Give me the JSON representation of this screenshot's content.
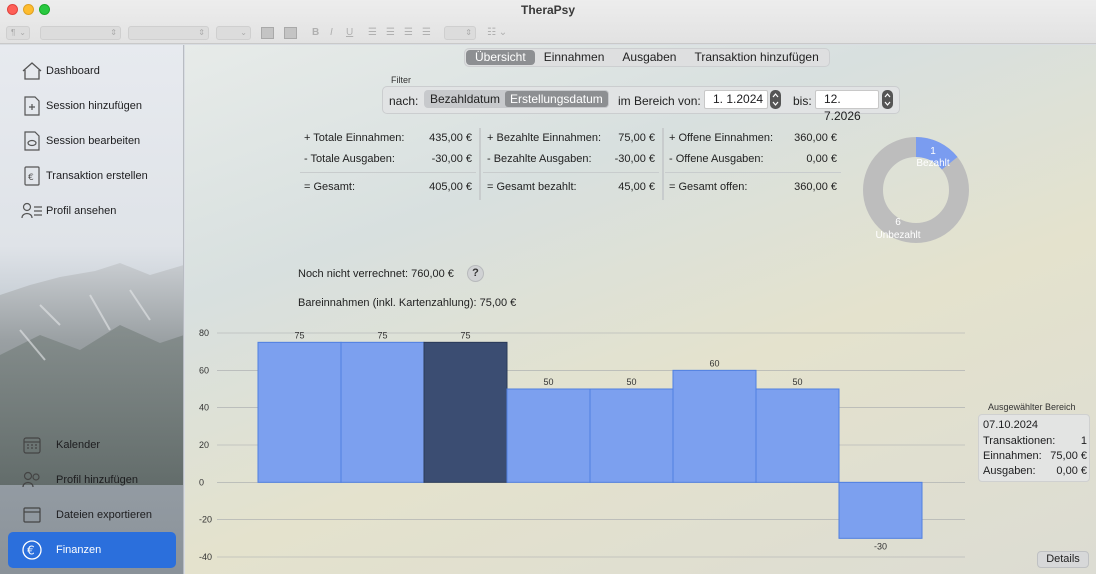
{
  "window": {
    "title": "TheraPsy"
  },
  "toolbar": {
    "paragraph_style": "¶",
    "bold": "B",
    "italic": "I",
    "underline": "U"
  },
  "sidebar": {
    "items": [
      {
        "label": "Dashboard",
        "icon": "house-icon"
      },
      {
        "label": "Session hinzufügen",
        "icon": "doc-plus-icon"
      },
      {
        "label": "Session bearbeiten",
        "icon": "doc-edit-icon"
      },
      {
        "label": "Transaktion erstellen",
        "icon": "euro-doc-icon"
      },
      {
        "label": "Profil ansehen",
        "icon": "person-list-icon"
      }
    ],
    "lower_items": [
      {
        "label": "Kalender",
        "icon": "calendar-icon"
      },
      {
        "label": "Profil hinzufügen",
        "icon": "person-plus-icon"
      },
      {
        "label": "Dateien exportieren",
        "icon": "archive-icon"
      },
      {
        "label": "Finanzen",
        "icon": "euro-circle-icon",
        "active": true
      }
    ]
  },
  "tabs": [
    "Übersicht",
    "Einnahmen",
    "Ausgaben",
    "Transaktion hinzufügen"
  ],
  "filter": {
    "title": "Filter",
    "by_label": "nach:",
    "options": [
      "Bezahldatum",
      "Erstellungsdatum"
    ],
    "selected": "Erstellungsdatum",
    "range_label": "im Bereich von:",
    "from": "1.  1.2024",
    "to_label": "bis:",
    "to": "12.  7.2026"
  },
  "stats": {
    "col1": [
      {
        "label": "+ Totale Einnahmen:",
        "value": "435,00 €"
      },
      {
        "label": "- Totale Ausgaben:",
        "value": "-30,00 €"
      },
      {
        "label": "= Gesamt:",
        "value": "405,00 €"
      }
    ],
    "col2": [
      {
        "label": "+ Bezahlte Einnahmen:",
        "value": "75,00 €"
      },
      {
        "label": "- Bezahlte Ausgaben:",
        "value": "-30,00 €"
      },
      {
        "label": "= Gesamt bezahlt:",
        "value": "45,00 €"
      }
    ],
    "col3": [
      {
        "label": "+ Offene Einnahmen:",
        "value": "360,00 €"
      },
      {
        "label": "- Offene Ausgaben:",
        "value": "0,00 €"
      },
      {
        "label": "= Gesamt offen:",
        "value": "360,00 €"
      }
    ]
  },
  "donut": {
    "paid": {
      "count": "1",
      "label": "Bezahlt",
      "value": 1,
      "color": "#7a9cf0"
    },
    "unpaid": {
      "count": "6",
      "label": "Unbezahlt",
      "value": 6,
      "color": "#bdbdbd"
    }
  },
  "not_billed": "Noch nicht verrechnet: 760,00 €",
  "help": "?",
  "cash_income": "Bareinnahmen (inkl. Kartenzahlung): 75,00 €",
  "chart_data": {
    "type": "bar",
    "categories": [
      "",
      "",
      "",
      "",
      "",
      "",
      "",
      ""
    ],
    "values": [
      75,
      75,
      75,
      50,
      50,
      60,
      50,
      -30
    ],
    "selected_index": 2,
    "ylim": [
      -40,
      80
    ],
    "yticks": [
      80,
      60,
      40,
      20,
      0,
      -20,
      -40
    ],
    "grid": true,
    "bar_color": "#7ca0ef",
    "selected_color": "#3b4d72",
    "title": "",
    "xlabel": "",
    "ylabel": ""
  },
  "selected_range": {
    "title": "Ausgewählter Bereich",
    "date": "07.10.2024",
    "transactions_label": "Transaktionen:",
    "transactions": "1",
    "income_label": "Einnahmen:",
    "income": "75,00 €",
    "expenses_label": "Ausgaben:",
    "expenses": "0,00 €"
  },
  "details_button": "Details"
}
